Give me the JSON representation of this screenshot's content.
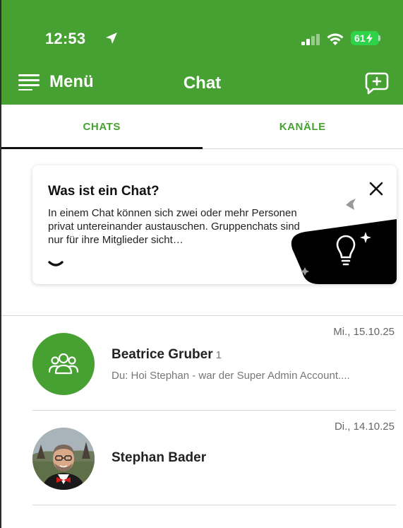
{
  "status_bar": {
    "time": "12:53",
    "battery": "61"
  },
  "nav": {
    "menu_label": "Menü",
    "title": "Chat"
  },
  "tabs": [
    {
      "label": "CHATS",
      "active": true
    },
    {
      "label": "KANÄLE",
      "active": false
    }
  ],
  "info_card": {
    "title": "Was ist ein Chat?",
    "text": "In einem Chat können sich zwei oder mehr Personen privat untereinander austauschen. Gruppenchats sind nur für ihre Mitglieder sicht…"
  },
  "chats": [
    {
      "name": "Beatrice Gruber",
      "count": "1",
      "date": "Mi., 15.10.25",
      "preview": "Du: Hoi Stephan - war der Super Admin Account....",
      "avatar": "group-icon"
    },
    {
      "name": "Stephan Bader",
      "count": "",
      "date": "Di., 14.10.25",
      "preview": "",
      "avatar": "profile-photo"
    }
  ],
  "colors": {
    "brand_green": "#46a032",
    "battery_green": "#2fd34a"
  },
  "icons": {
    "location": "location-arrow-icon",
    "signal": "cellular-signal-icon",
    "wifi": "wifi-icon",
    "menu": "hamburger-menu-icon",
    "new_chat": "new-chat-icon",
    "close": "close-icon",
    "expand": "chevron-down-icon",
    "tip": "lightbulb-icon"
  }
}
